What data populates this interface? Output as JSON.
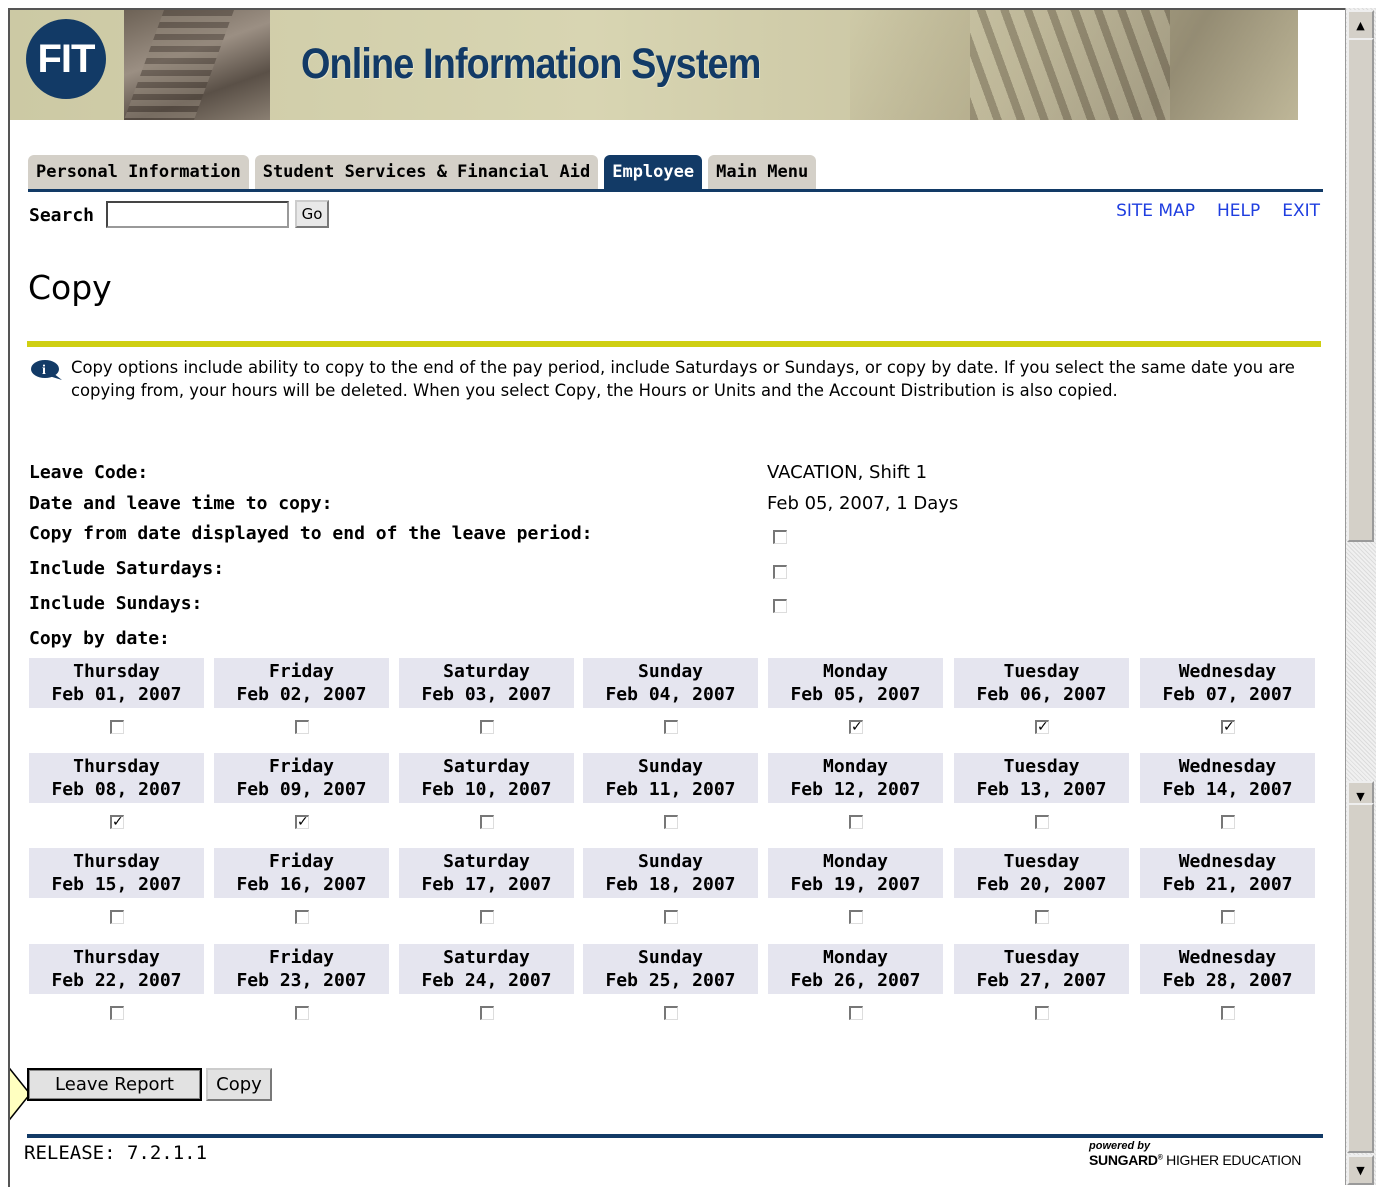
{
  "banner": {
    "logo_text": "FIT",
    "title": "Online Information System"
  },
  "tabs": [
    {
      "label": "Personal Information",
      "active": false
    },
    {
      "label": "Student Services & Financial Aid",
      "active": false
    },
    {
      "label": "Employee",
      "active": true
    },
    {
      "label": "Main Menu",
      "active": false
    }
  ],
  "search": {
    "label": "Search",
    "value": "",
    "button": "Go"
  },
  "toplinks": {
    "site_map": "SITE MAP",
    "help": "HELP",
    "exit": "EXIT"
  },
  "page": {
    "title": "Copy",
    "info": "Copy options include ability to copy to the end of the pay period, include Saturdays or Sundays, or copy by date. If you select the same date you are copying from, your hours will be deleted. When you select Copy, the Hours or Units and the Account Distribution is also copied."
  },
  "form": {
    "leave_code_label": "Leave Code:",
    "leave_code_value": "VACATION, Shift 1",
    "date_label": "Date and leave time to copy:",
    "date_value": "Feb 05, 2007, 1 Days",
    "copy_to_end_label": "Copy from date displayed to end of the leave period:",
    "copy_to_end_checked": false,
    "include_sat_label": "Include Saturdays:",
    "include_sat_checked": false,
    "include_sun_label": "Include Sundays:",
    "include_sun_checked": false,
    "copy_by_date_label": "Copy by date:"
  },
  "calendar": [
    [
      {
        "day": "Thursday",
        "date": "Feb 01, 2007",
        "checked": false
      },
      {
        "day": "Friday",
        "date": "Feb 02, 2007",
        "checked": false
      },
      {
        "day": "Saturday",
        "date": "Feb 03, 2007",
        "checked": false
      },
      {
        "day": "Sunday",
        "date": "Feb 04, 2007",
        "checked": false
      },
      {
        "day": "Monday",
        "date": "Feb 05, 2007",
        "checked": true
      },
      {
        "day": "Tuesday",
        "date": "Feb 06, 2007",
        "checked": true
      },
      {
        "day": "Wednesday",
        "date": "Feb 07, 2007",
        "checked": true
      }
    ],
    [
      {
        "day": "Thursday",
        "date": "Feb 08, 2007",
        "checked": true
      },
      {
        "day": "Friday",
        "date": "Feb 09, 2007",
        "checked": true
      },
      {
        "day": "Saturday",
        "date": "Feb 10, 2007",
        "checked": false
      },
      {
        "day": "Sunday",
        "date": "Feb 11, 2007",
        "checked": false
      },
      {
        "day": "Monday",
        "date": "Feb 12, 2007",
        "checked": false
      },
      {
        "day": "Tuesday",
        "date": "Feb 13, 2007",
        "checked": false
      },
      {
        "day": "Wednesday",
        "date": "Feb 14, 2007",
        "checked": false
      }
    ],
    [
      {
        "day": "Thursday",
        "date": "Feb 15, 2007",
        "checked": false
      },
      {
        "day": "Friday",
        "date": "Feb 16, 2007",
        "checked": false
      },
      {
        "day": "Saturday",
        "date": "Feb 17, 2007",
        "checked": false
      },
      {
        "day": "Sunday",
        "date": "Feb 18, 2007",
        "checked": false
      },
      {
        "day": "Monday",
        "date": "Feb 19, 2007",
        "checked": false
      },
      {
        "day": "Tuesday",
        "date": "Feb 20, 2007",
        "checked": false
      },
      {
        "day": "Wednesday",
        "date": "Feb 21, 2007",
        "checked": false
      }
    ],
    [
      {
        "day": "Thursday",
        "date": "Feb 22, 2007",
        "checked": false
      },
      {
        "day": "Friday",
        "date": "Feb 23, 2007",
        "checked": false
      },
      {
        "day": "Saturday",
        "date": "Feb 24, 2007",
        "checked": false
      },
      {
        "day": "Sunday",
        "date": "Feb 25, 2007",
        "checked": false
      },
      {
        "day": "Monday",
        "date": "Feb 26, 2007",
        "checked": false
      },
      {
        "day": "Tuesday",
        "date": "Feb 27, 2007",
        "checked": false
      },
      {
        "day": "Wednesday",
        "date": "Feb 28, 2007",
        "checked": false
      }
    ]
  ],
  "buttons": {
    "leave_report": "Leave Report",
    "copy": "Copy"
  },
  "footer": {
    "release": "RELEASE: 7.2.1.1",
    "powered_by": "powered by",
    "brand": "SUNGARD",
    "brand_suffix": "HIGHER EDUCATION"
  },
  "colors": {
    "navy": "#123a66",
    "accent_rule": "#cfcf12",
    "link": "#1f3ee0",
    "cell_bg": "#e5e5ef"
  }
}
